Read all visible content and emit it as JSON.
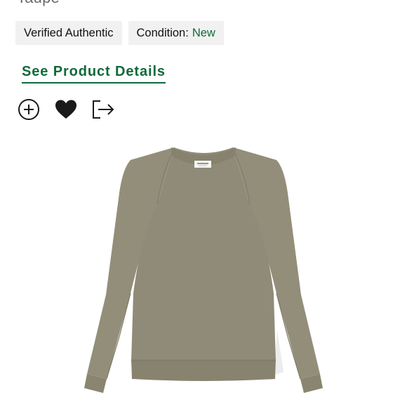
{
  "product": {
    "title_partial": "Taupe"
  },
  "badges": {
    "verified_label": "Verified Authentic",
    "condition_label": "Condition:",
    "condition_value": "New"
  },
  "links": {
    "see_product_details": "See Product Details"
  },
  "actions": {
    "add_icon": "plus-circle-icon",
    "favorite_icon": "heart-icon",
    "share_icon": "share-exit-icon"
  },
  "image": {
    "neck_label_text": "ESSENTIALS"
  },
  "colors": {
    "accent_green": "#0f6a3a",
    "badge_bg": "#f1f1f1",
    "garment": "#8f8b78"
  }
}
